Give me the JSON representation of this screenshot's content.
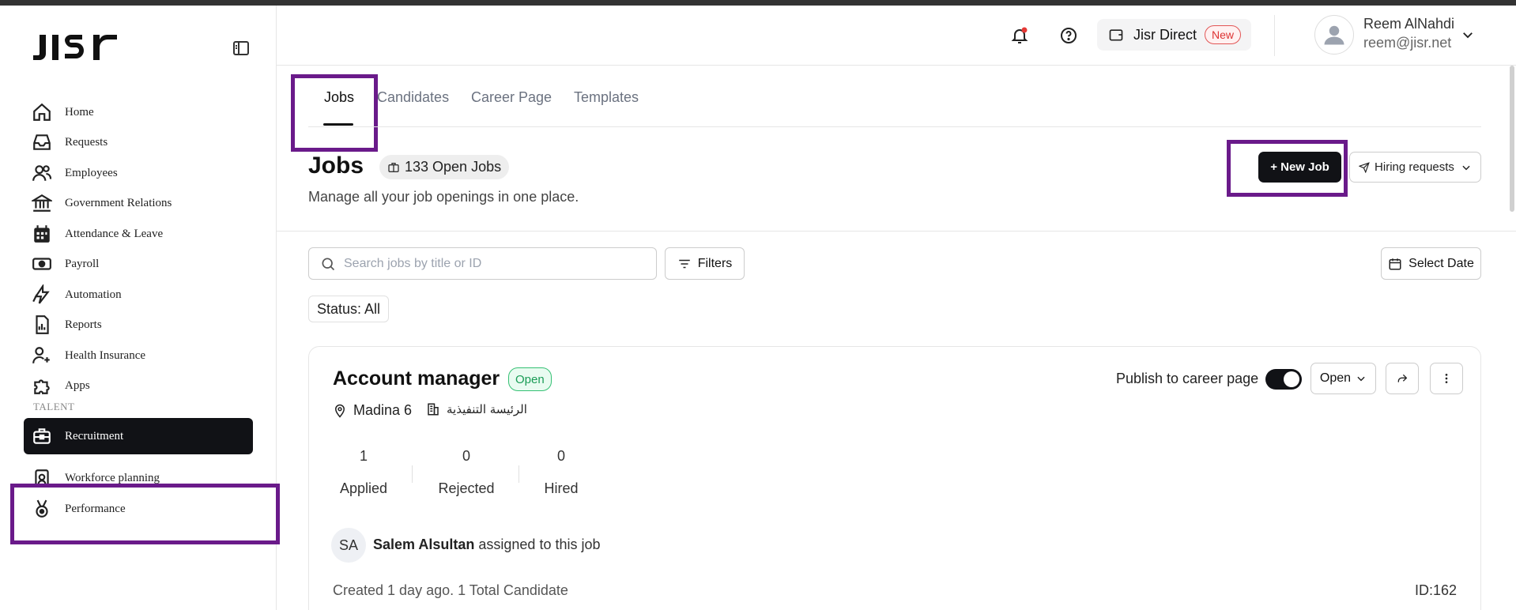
{
  "brand": {
    "logo_text": "JISr"
  },
  "sidebar": {
    "items": [
      {
        "label": "Home",
        "icon": "home-icon"
      },
      {
        "label": "Requests",
        "icon": "inbox-icon"
      },
      {
        "label": "Employees",
        "icon": "users-icon"
      },
      {
        "label": "Government Relations",
        "icon": "bank-icon"
      },
      {
        "label": "Attendance & Leave",
        "icon": "calendar-icon"
      },
      {
        "label": "Payroll",
        "icon": "cash-icon"
      },
      {
        "label": "Automation",
        "icon": "automation-icon"
      },
      {
        "label": "Reports",
        "icon": "report-icon"
      },
      {
        "label": "Health Insurance",
        "icon": "health-insurance-icon"
      },
      {
        "label": "Apps",
        "icon": "puzzle-icon"
      }
    ],
    "section_talent": "TALENT",
    "talent_items": [
      {
        "label": "Recruitment",
        "icon": "briefcase-icon",
        "active": true
      },
      {
        "label": "Workforce planning",
        "icon": "badge-icon"
      },
      {
        "label": "Performance",
        "icon": "medal-icon"
      }
    ]
  },
  "header": {
    "jisr_direct_label": "Jisr Direct",
    "new_badge": "New",
    "user_name": "Reem AlNahdi",
    "user_email": "reem@jisr.net"
  },
  "tabs": [
    {
      "label": "Jobs",
      "active": true
    },
    {
      "label": "Candidates"
    },
    {
      "label": "Career Page"
    },
    {
      "label": "Templates"
    }
  ],
  "page": {
    "title": "Jobs",
    "open_jobs_badge": "133 Open Jobs",
    "subtitle": "Manage all your job openings in one place.",
    "new_job_label": "+ New Job",
    "hiring_requests_label": "Hiring requests"
  },
  "toolbar": {
    "search_placeholder": "Search jobs by title or ID",
    "filters_label": "Filters",
    "select_date_label": "Select Date",
    "status_chip": "Status: All"
  },
  "job": {
    "title": "Account manager",
    "status_badge": "Open",
    "location": "Madina 6",
    "department": "الرئيسة التنفيذية",
    "publish_label": "Publish to career page",
    "publish_on": true,
    "status_dropdown": "Open",
    "stats": [
      {
        "value": "1",
        "label": "Applied"
      },
      {
        "value": "0",
        "label": "Rejected"
      },
      {
        "value": "0",
        "label": "Hired"
      }
    ],
    "assignee_initials": "SA",
    "assignee_name": "Salem Alsultan",
    "assigned_text": "assigned to this job",
    "created_text": "Created 1 day ago. 1 Total Candidate",
    "id_text": "ID:162"
  },
  "colors": {
    "accent": "#111216",
    "highlight": "#6a1a8a",
    "open_green": "#1a9c56",
    "notification_dot": "#e53935"
  }
}
